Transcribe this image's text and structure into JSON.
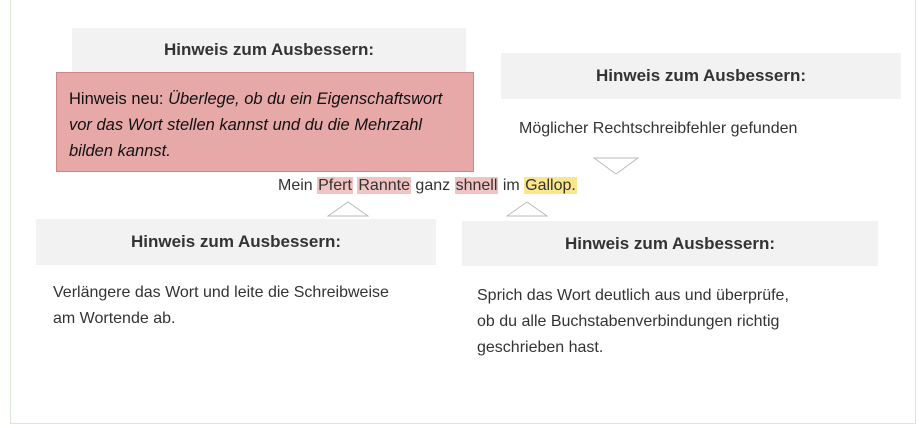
{
  "hint_heading": "Hinweis zum Ausbessern:",
  "top_left": {
    "note_prefix": "Hinweis neu: ",
    "note_italic": "Überlege, ob du ein Eigenschaftswort vor das Wort stellen kannst und du die Mehrzahl bilden kannst."
  },
  "top_right": {
    "body": "Möglicher Rechtschreibfehler gefunden"
  },
  "sentence": {
    "w1": "Mein ",
    "w2": "Pfert",
    "w3": " ",
    "w4": "Rannte",
    "w5": " ganz ",
    "w6": "shnell",
    "w7": " im ",
    "w8": "Gallop."
  },
  "bottom_left": {
    "body": "Verlängere das Wort und leite die Schreibweise am Wortende ab."
  },
  "bottom_right": {
    "body": "Sprich das Wort deutlich aus und überprüfe, ob du alle Buchstabenverbindungen richtig geschrieben hast."
  },
  "colors": {
    "error_highlight": "#f2c3c3",
    "warning_highlight": "#fce68c",
    "note_background": "#e7a9a8"
  }
}
